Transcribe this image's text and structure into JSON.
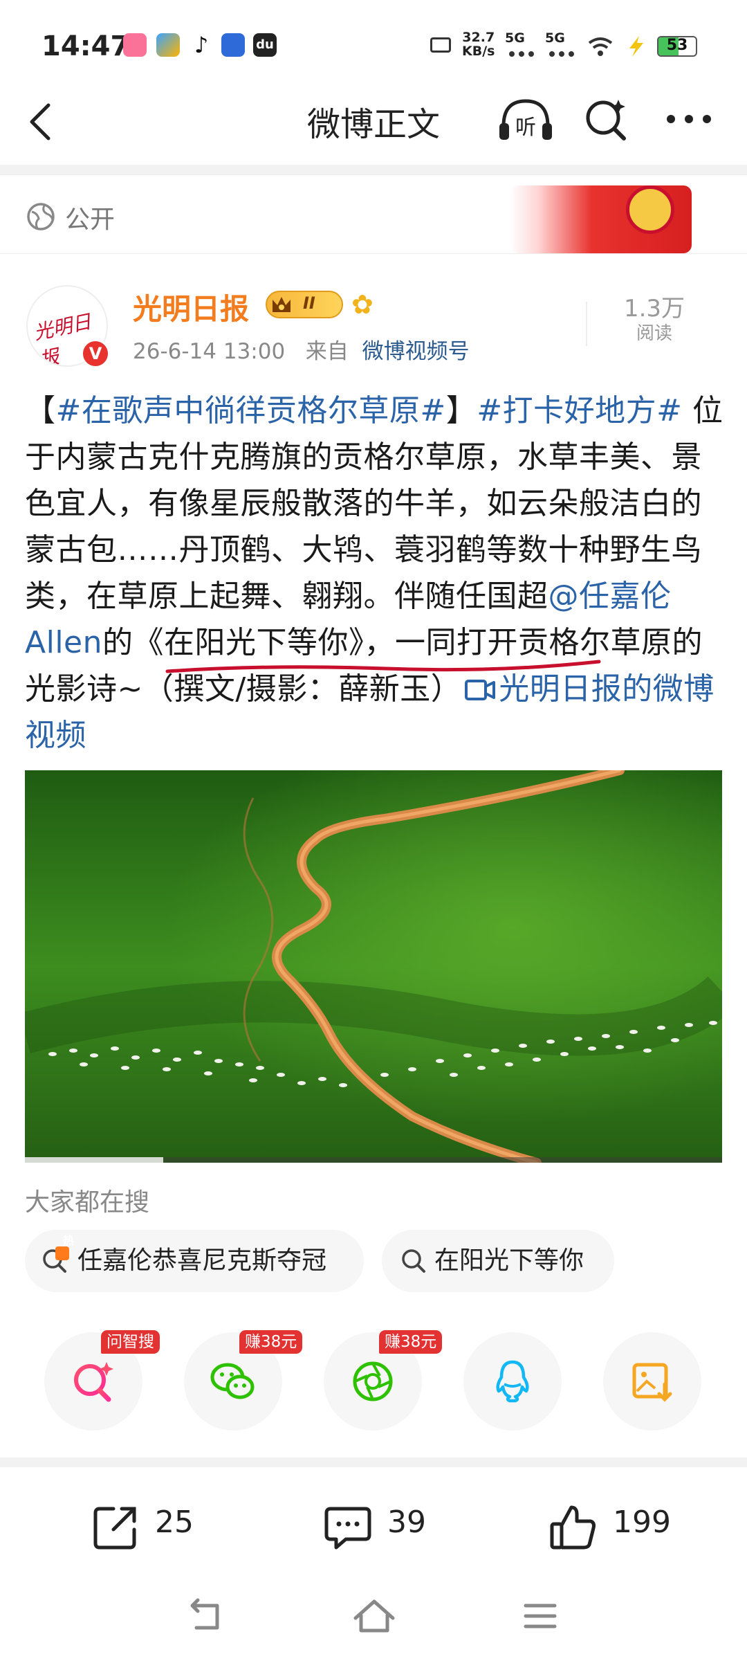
{
  "status_bar": {
    "time": "14:47",
    "net_speed_value": "32.7",
    "net_speed_unit": "KB/s",
    "sig1": "5G",
    "sig2": "5G",
    "battery": "53",
    "battery_level": 0.53
  },
  "nav": {
    "title": "微博正文"
  },
  "visibility": {
    "label": "公开"
  },
  "author": {
    "name": "光明日报",
    "level_badge": "II",
    "avatar_text": "光明日报",
    "verified_mark": "V",
    "date": "26-6-14 13:00",
    "source_prefix": "来自",
    "source": "微博视频号",
    "views_value": "1.3万",
    "views_label": "阅读"
  },
  "post": {
    "bracket_open": "【",
    "topic1": "#在歌声中徜徉贡格尔草原#",
    "bracket_close": "】",
    "topic2": "#打卡好地方#",
    "text1": " 位于内蒙古克什克腾旗的贡格尔草原，水草丰美、景色宜人，有像星辰般散落的牛羊，如云朵般洁白的蒙古包……丹顶鹤、大鸨、蓑羽鹤等数十种野生鸟类，在草原上起舞、翱翔。伴随任国超",
    "mention": "@任嘉伦Allen",
    "text2": "的《在阳光下等你》，一同打开贡格尔草原的光影诗~（撰文/摄影：薛新玉）",
    "video_link": "光明日报的微博视频"
  },
  "search": {
    "heading": "大家都在搜",
    "chips": [
      {
        "label": "任嘉伦恭喜尼克斯夺冠",
        "icon": "hot-search-icon",
        "badge": "热"
      },
      {
        "label": "在阳光下等你",
        "icon": "search-icon"
      }
    ]
  },
  "share": {
    "items": [
      {
        "name": "wenzhisou",
        "icon": "ai-search-icon",
        "badge": "问智搜"
      },
      {
        "name": "wechat",
        "icon": "wechat-icon",
        "badge": "赚38元"
      },
      {
        "name": "moments",
        "icon": "moments-icon",
        "badge": "赚38元"
      },
      {
        "name": "qq",
        "icon": "qq-icon"
      },
      {
        "name": "save-image",
        "icon": "save-image-icon"
      }
    ]
  },
  "actions": {
    "repost_count": "25",
    "comment_count": "39",
    "like_count": "199"
  },
  "colors": {
    "link": "#2b63a8",
    "author": "#f27c1e",
    "badge_red": "#e23232",
    "wechat_green": "#2dc100",
    "qq_blue": "#12b7f5",
    "save_orange": "#f5a623"
  }
}
